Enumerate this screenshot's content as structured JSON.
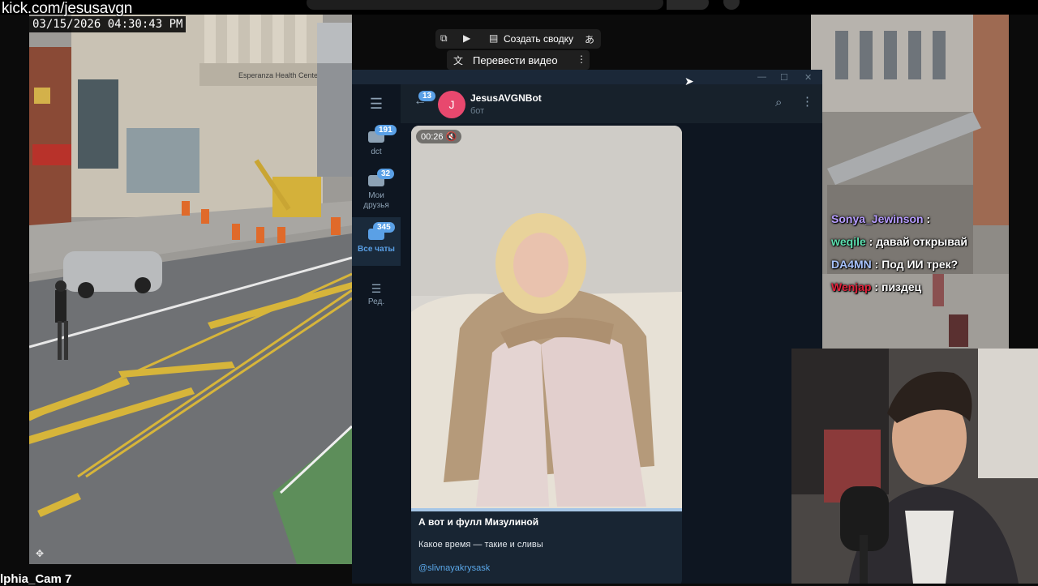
{
  "stream": {
    "url": "kick.com/jesusavgn"
  },
  "street_cam": {
    "timestamp": "03/15/2026 04:30:43 PM",
    "camera_label": "lphia_Cam 7",
    "building_sign": "Esperanza Health Center"
  },
  "browser_overlay": {
    "summary_label": "Создать сводку",
    "translate_label": "Перевести видео",
    "translate_glyph": "あ",
    "more_glyph": "⋮"
  },
  "telegram": {
    "window_controls": [
      "—",
      "☐",
      "✕"
    ],
    "menu_icon": "☰",
    "folders": [
      {
        "label": "dct",
        "badge": "191",
        "active": false
      },
      {
        "label": "Мои друзья",
        "badge": "32",
        "active": false
      },
      {
        "label": "Все чаты",
        "badge": "345",
        "active": true
      },
      {
        "label": "Ред.",
        "badge": "",
        "active": false
      }
    ],
    "back_badge": "13",
    "chat": {
      "avatar_letter": "J",
      "name": "JesusAVGNBot",
      "subtitle": "бот"
    },
    "message": {
      "video_duration": "00:26",
      "caption_title": "А вот и фулл Мизулиной",
      "caption_text": "Какое время — такие и сливы",
      "caption_link": "@slivnayakrysask"
    },
    "colors": {
      "accent": "#5aa0e6",
      "avatar": "#e8486e",
      "link": "#5aa7e8"
    }
  },
  "stream_chat": [
    {
      "user": "Sonya_Jewinson",
      "message": "",
      "color": "#b69cff"
    },
    {
      "user": "weqile",
      "message": "давай открывай",
      "color": "#5de0b0"
    },
    {
      "user": "DA4MN",
      "message": "Под ИИ трек?",
      "color": "#a9c4ff"
    },
    {
      "user": "Wenjap",
      "message": "пиздец",
      "color": "#e0233c"
    }
  ]
}
